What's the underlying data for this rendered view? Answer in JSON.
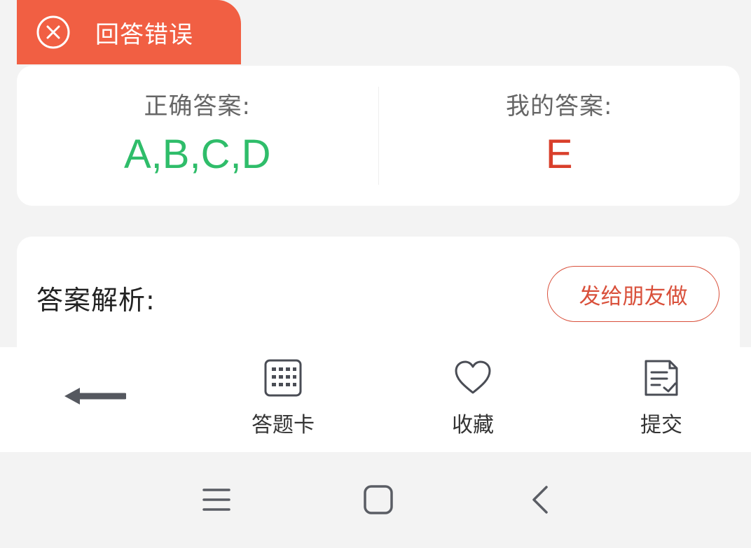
{
  "result_tab": {
    "label": "回答错误",
    "icon": "close-circle-icon",
    "color": "#f15f43"
  },
  "answers": {
    "correct_label": "正确答案:",
    "correct_value": "A,B,C,D",
    "mine_label": "我的答案:",
    "mine_value": "E",
    "correct_color": "#2fbd6a",
    "mine_color": "#d93f2b"
  },
  "analysis": {
    "title": "答案解析:",
    "share_button": "发给朋友做"
  },
  "toolbar": {
    "back_icon": "arrow-left-icon",
    "items": [
      {
        "label": "答题卡",
        "icon": "grid-card-icon"
      },
      {
        "label": "收藏",
        "icon": "heart-icon"
      },
      {
        "label": "提交",
        "icon": "submit-doc-icon"
      }
    ]
  },
  "system_nav": {
    "icons": [
      "menu-icon",
      "home-icon",
      "back-icon"
    ]
  }
}
